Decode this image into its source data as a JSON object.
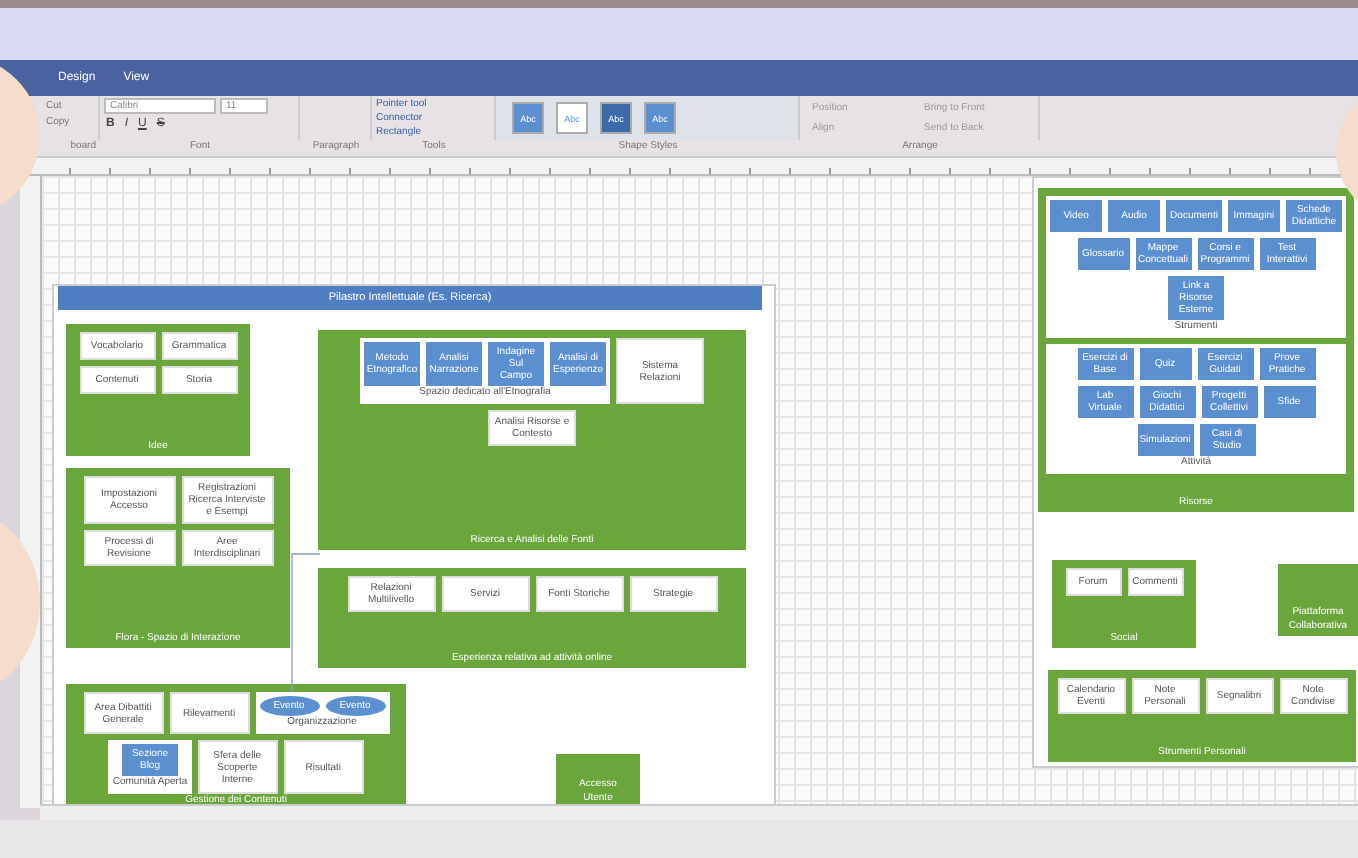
{
  "menu_tabs": [
    {
      "label": "Design",
      "selected": false
    },
    {
      "label": "View",
      "selected": false
    }
  ],
  "ribbon": {
    "clipboard": {
      "cut": "Cut",
      "copy": "Copy"
    },
    "font": {
      "family": "Calibri",
      "size": "11",
      "format": [
        "B",
        "I",
        "U",
        "S"
      ]
    },
    "tools": [
      "Pointer tool",
      "Connector",
      "Rectangle"
    ],
    "shape_styles": [
      "Abc",
      "Abc",
      "Abc",
      "Abc"
    ],
    "arrange": [
      "Position",
      "Bring to Front",
      "Align",
      "Send to Back"
    ],
    "group_labels": [
      "board",
      "Font",
      "Paragraph",
      "Tools",
      "Shape Styles",
      "Arrange"
    ]
  },
  "diagram": {
    "header": "Pilastro Intellettuale (Es. Ricerca)",
    "containers": [
      {
        "title": "Idee",
        "items": [
          {
            "kind": "box",
            "label": "Vocabolario"
          },
          {
            "kind": "box",
            "label": "Grammatica"
          },
          {
            "kind": "box",
            "label": "Contenuti"
          },
          {
            "kind": "box",
            "label": "Storia"
          }
        ]
      },
      {
        "title": "Flora - Spazio di Interazione",
        "items": [
          {
            "kind": "box",
            "label": "Impostazioni Accesso"
          },
          {
            "kind": "box",
            "label": "Registrazioni Ricerca Interviste e Esempi"
          },
          {
            "kind": "box",
            "label": "Processi di Revisione"
          },
          {
            "kind": "box",
            "label": "Aree Interdisciplinari"
          }
        ]
      },
      {
        "title": "Ricerca e Analisi delle Fonti",
        "items": [
          {
            "kind": "panel",
            "label": "Spazio dedicato all'Etnografia",
            "items": [
              {
                "kind": "blue",
                "label": "Metodo Etnografico"
              },
              {
                "kind": "blue",
                "label": "Analisi Narrazione"
              },
              {
                "kind": "blue",
                "label": "Indagine Sul Campo"
              },
              {
                "kind": "blue",
                "label": "Analisi di Esperienze"
              }
            ]
          },
          {
            "kind": "box",
            "label": "Sistema Relazioni"
          },
          {
            "kind": "box",
            "label": "Analisi Risorse e Contesto"
          }
        ]
      },
      {
        "title": "Esperienza relativa ad attività online",
        "items": [
          {
            "kind": "box",
            "label": "Relazioni Multilivello"
          },
          {
            "kind": "box",
            "label": "Servizi"
          },
          {
            "kind": "box",
            "label": "Fonti Storiche"
          },
          {
            "kind": "box",
            "label": "Strategie"
          }
        ]
      },
      {
        "title": "Gestione dei Contenuti",
        "items": [
          {
            "kind": "box",
            "label": "Area Dibattiti Generale"
          },
          {
            "kind": "box",
            "label": "Rilevamenti"
          },
          {
            "kind": "panel",
            "label": "Organizzazione",
            "items": [
              {
                "kind": "ellipse",
                "label": "Evento"
              },
              {
                "kind": "ellipse",
                "label": "Evento"
              }
            ]
          },
          {
            "kind": "panel",
            "label": "Comunità Aperta",
            "items": [
              {
                "kind": "blue",
                "label": "Sezione Blog"
              }
            ]
          },
          {
            "kind": "box",
            "label": "Sfera delle Scoperte Interne"
          },
          {
            "kind": "box",
            "label": "Risultati"
          }
        ]
      },
      {
        "title": "Accesso Utente"
      },
      {
        "title": "Risorse",
        "items": [
          {
            "kind": "panel",
            "label": "Strumenti",
            "items": [
              {
                "kind": "blue",
                "label": "Video"
              },
              {
                "kind": "blue",
                "label": "Audio"
              },
              {
                "kind": "blue",
                "label": "Documenti"
              },
              {
                "kind": "blue",
                "label": "Immagini"
              },
              {
                "kind": "blue",
                "label": "Schede Didattiche"
              },
              {
                "kind": "blue",
                "label": "Glossario"
              },
              {
                "kind": "blue",
                "label": "Mappe Concettuali"
              },
              {
                "kind": "blue",
                "label": "Corsi e Programmi"
              },
              {
                "kind": "blue",
                "label": "Test Interattivi"
              },
              {
                "kind": "blue",
                "label": "Link a Risorse Esterne"
              }
            ]
          },
          {
            "kind": "panel",
            "label": "Attività",
            "items": [
              {
                "kind": "blue",
                "label": "Esercizi di Base"
              },
              {
                "kind": "blue",
                "label": "Quiz"
              },
              {
                "kind": "blue",
                "label": "Esercizi Guidati"
              },
              {
                "kind": "blue",
                "label": "Prove Pratiche"
              },
              {
                "kind": "blue",
                "label": "Lab Virtuale"
              },
              {
                "kind": "blue",
                "label": "Giochi Didattici"
              },
              {
                "kind": "blue",
                "label": "Progetti Collettivi"
              },
              {
                "kind": "blue",
                "label": "Sfide"
              },
              {
                "kind": "blue",
                "label": "Simulazioni"
              },
              {
                "kind": "blue",
                "label": "Casi di Studio"
              }
            ]
          }
        ]
      },
      {
        "title": "Social",
        "items": [
          {
            "kind": "box",
            "label": "Forum"
          },
          {
            "kind": "box",
            "label": "Commenti"
          }
        ]
      },
      {
        "title": "Piattaforma Collaborativa"
      },
      {
        "title": "Strumenti Personali",
        "items": [
          {
            "kind": "box",
            "label": "Calendario Eventi"
          },
          {
            "kind": "box",
            "label": "Note Personali"
          },
          {
            "kind": "box",
            "label": "Segnalibri"
          },
          {
            "kind": "box",
            "label": "Note Condivise"
          }
        ]
      }
    ]
  }
}
